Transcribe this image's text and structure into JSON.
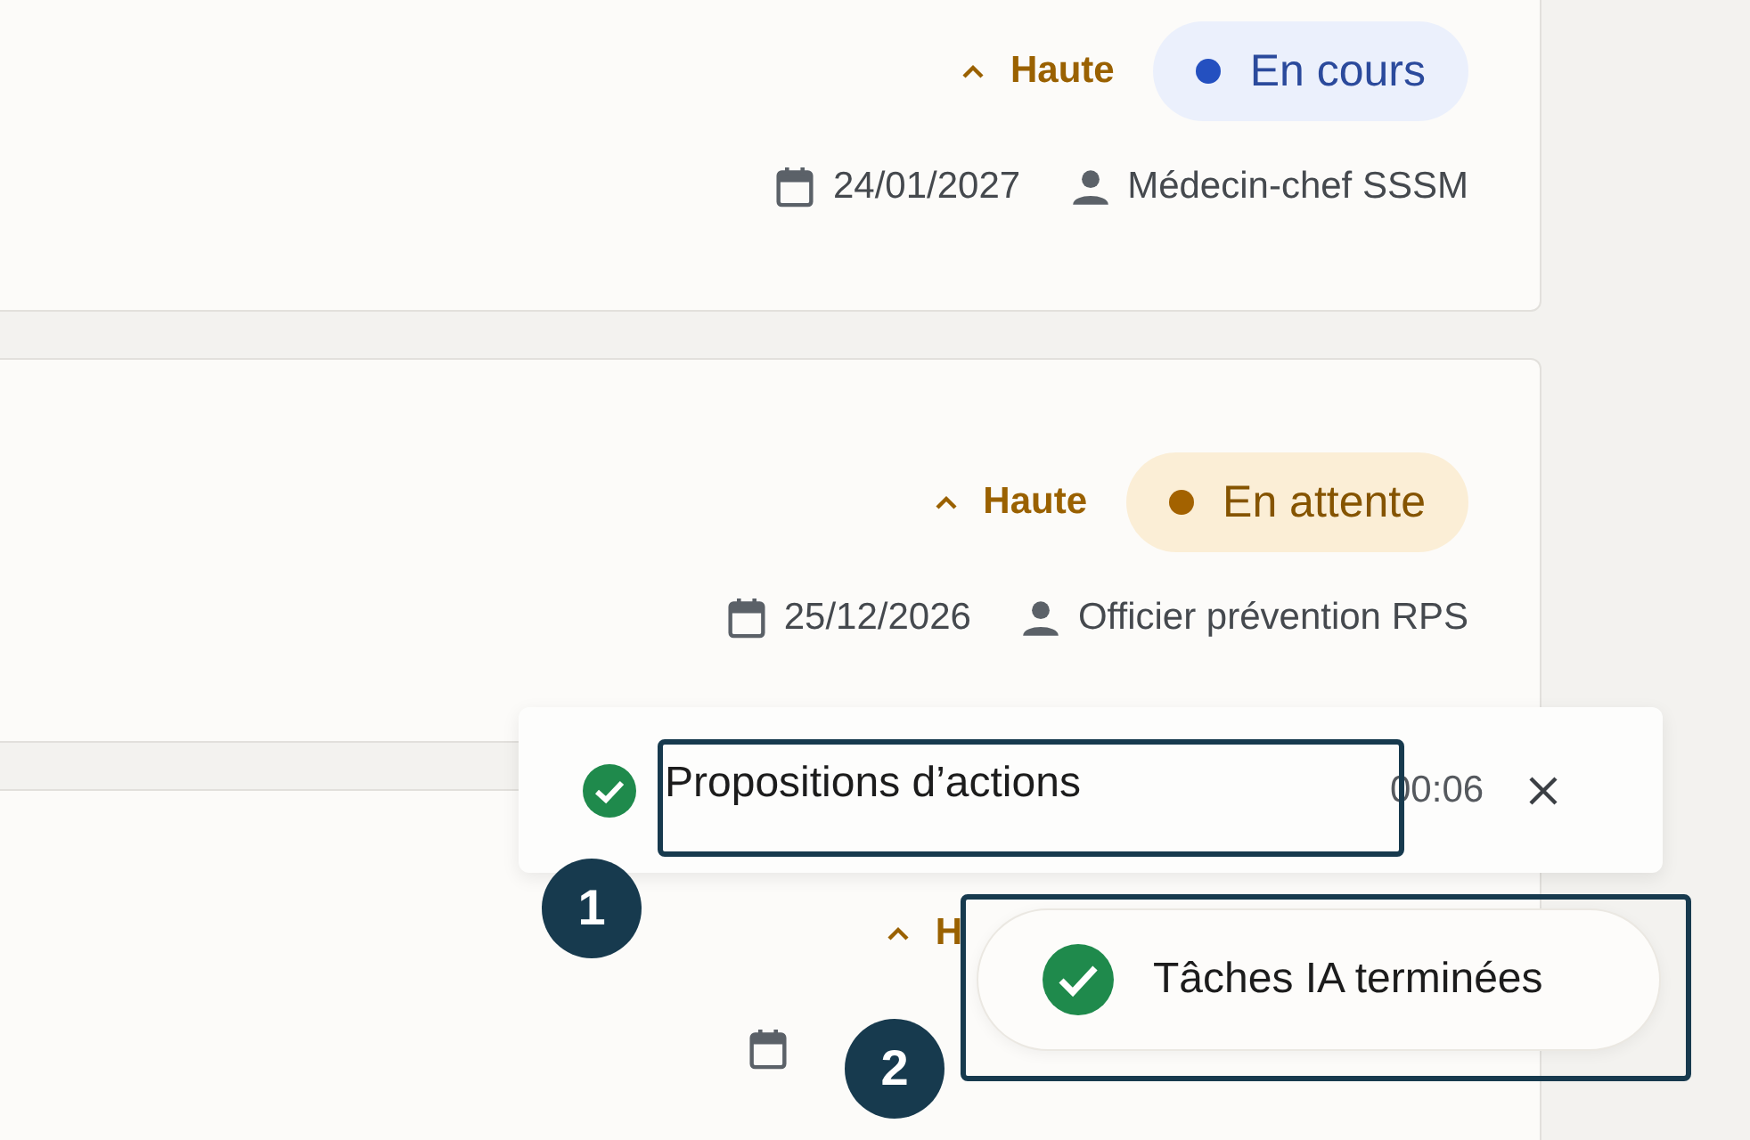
{
  "tasks": [
    {
      "priority": {
        "label": "Haute"
      },
      "status": {
        "label": "En cours",
        "kind": "in_progress"
      },
      "date": "24/01/2027",
      "assignee": "Médecin-chef SSSM"
    },
    {
      "priority": {
        "label": "Haute"
      },
      "status": {
        "label": "En attente",
        "kind": "pending"
      },
      "date": "25/12/2026",
      "assignee": "Officier prévention RPS"
    },
    {
      "priority": {
        "label": "H"
      }
    }
  ],
  "task_toast": {
    "label": "Propositions d’actions",
    "time": "00:06"
  },
  "done_toast": {
    "label": "Tâches IA terminées"
  },
  "annotations": [
    {
      "number": "1"
    },
    {
      "number": "2"
    }
  ]
}
